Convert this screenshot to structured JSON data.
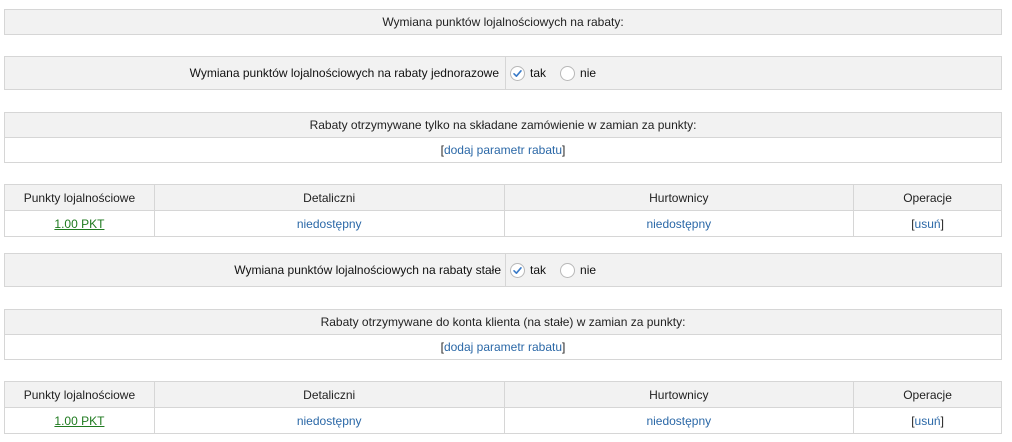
{
  "section_title": "Wymiana punktów lojalnościowych na rabaty:",
  "one_time": {
    "label": "Wymiana punktów lojalnościowych na rabaty jednorazowe",
    "options": [
      {
        "label": "tak",
        "selected": true
      },
      {
        "label": "nie",
        "selected": false
      }
    ],
    "list_header": "Rabaty otrzymywane tylko na składane zamówienie w zamian za punkty:",
    "add_param": {
      "open": "[",
      "link": "dodaj parametr rabatu",
      "close": "]"
    },
    "table": {
      "headers": [
        "Punkty lojalnościowe",
        "Detaliczni",
        "Hurtownicy",
        "Operacje"
      ],
      "rows": [
        {
          "points": "1.00 PKT",
          "retail": "niedostępny",
          "wholesale": "niedostępny",
          "op_open": "[",
          "op_link": "usuń",
          "op_close": "]"
        }
      ]
    }
  },
  "permanent": {
    "label": "Wymiana punktów lojalnościowych na rabaty stałe",
    "options": [
      {
        "label": "tak",
        "selected": true
      },
      {
        "label": "nie",
        "selected": false
      }
    ],
    "list_header": "Rabaty otrzymywane do konta klienta (na stałe) w zamian za punkty:",
    "add_param": {
      "open": "[",
      "link": "dodaj parametr rabatu",
      "close": "]"
    },
    "table": {
      "headers": [
        "Punkty lojalnościowe",
        "Detaliczni",
        "Hurtownicy",
        "Operacje"
      ],
      "rows": [
        {
          "points": "1.00 PKT",
          "retail": "niedostępny",
          "wholesale": "niedostępny",
          "op_open": "[",
          "op_link": "usuń",
          "op_close": "]"
        }
      ]
    }
  },
  "colors": {
    "link": "#2b68a7",
    "points_link": "#1f7a1f",
    "header_bg": "#f2f2f2",
    "border": "#d6d6d6",
    "radio_check": "#3a7bc8"
  },
  "icons": {
    "radio_selected": "checkmark-icon"
  }
}
